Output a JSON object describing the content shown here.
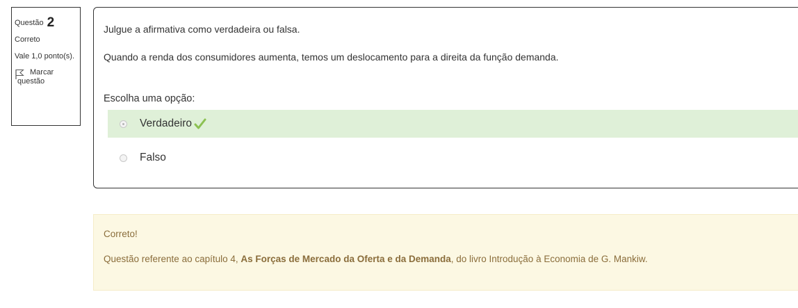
{
  "info": {
    "question_label": "Questão",
    "question_number": "2",
    "state": "Correto",
    "grade": "Vale 1,0 ponto(s).",
    "flag_line1": "Marcar",
    "flag_line2": "questão"
  },
  "question": {
    "text_line1": "Julgue a afirmativa como verdadeira ou falsa.",
    "text_line2": "Quando a renda dos consumidores aumenta, temos um deslocamento para a direita da função demanda.",
    "prompt": "Escolha uma opção:",
    "options": [
      {
        "label": "Verdadeiro",
        "selected": true,
        "correct": true
      },
      {
        "label": "Falso",
        "selected": false,
        "correct": false
      }
    ]
  },
  "feedback": {
    "title": "Correto!",
    "text_before": "Questão referente ao capítulo 4, ",
    "text_bold": "As Forças de Mercado da Oferta e da Demanda",
    "text_after": ", do livro Introdução à Economia de G. Mankiw."
  },
  "colors": {
    "correct_bg": "#dff0d8",
    "check": "#8cc152",
    "feedback_bg": "#fcf8e3",
    "feedback_text": "#8a6d3b"
  }
}
